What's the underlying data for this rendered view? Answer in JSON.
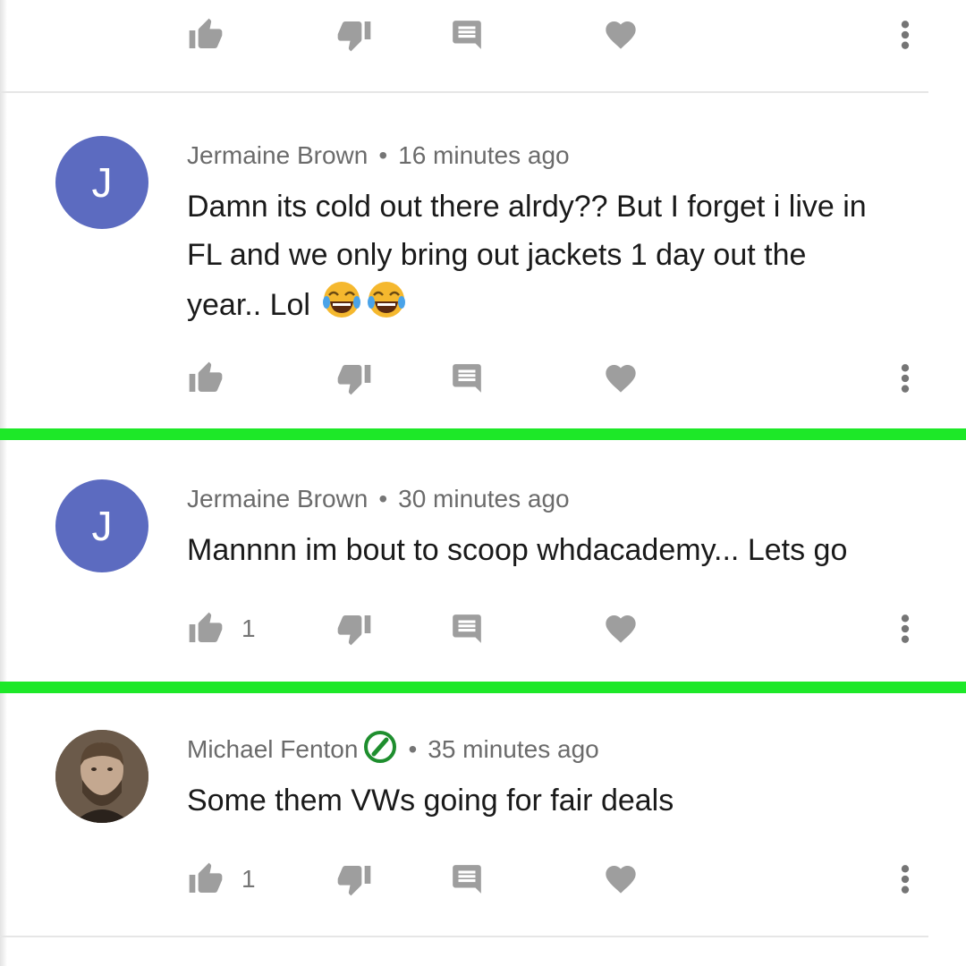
{
  "icons": {
    "like": "thumbs-up-icon",
    "dislike": "thumbs-down-icon",
    "reply": "comment-icon",
    "heart": "heart-icon",
    "more": "more-vert-icon",
    "verified": "verified-badge-icon",
    "emoji": "face-with-tears-of-joy-emoji"
  },
  "colors": {
    "icon_gray": "#9e9e9e",
    "avatar_indigo": "#5c6bc0",
    "highlight_green": "#1de828",
    "verified_green": "#1e8e2e"
  },
  "top_actions": {
    "like_count": ""
  },
  "comments": [
    {
      "author": "Jermaine Brown",
      "separator": "•",
      "time": "16 minutes ago",
      "avatar_initial": "J",
      "lines": [
        "Damn its cold out there alrdy?? But I forget i live in",
        "FL and we only bring out jackets 1 day out the",
        "year.. Lol"
      ],
      "emoji": "😂😂",
      "like_count": ""
    },
    {
      "author": "Jermaine Brown",
      "separator": "•",
      "time": "30 minutes ago",
      "avatar_initial": "J",
      "lines": [
        "Mannnn im bout to scoop whdacademy... Lets go"
      ],
      "like_count": "1"
    },
    {
      "author": "Michael Fenton",
      "separator": "•",
      "time": "35 minutes ago",
      "avatar_initial": "",
      "lines": [
        "Some them VWs going for fair deals"
      ],
      "like_count": "1"
    }
  ]
}
